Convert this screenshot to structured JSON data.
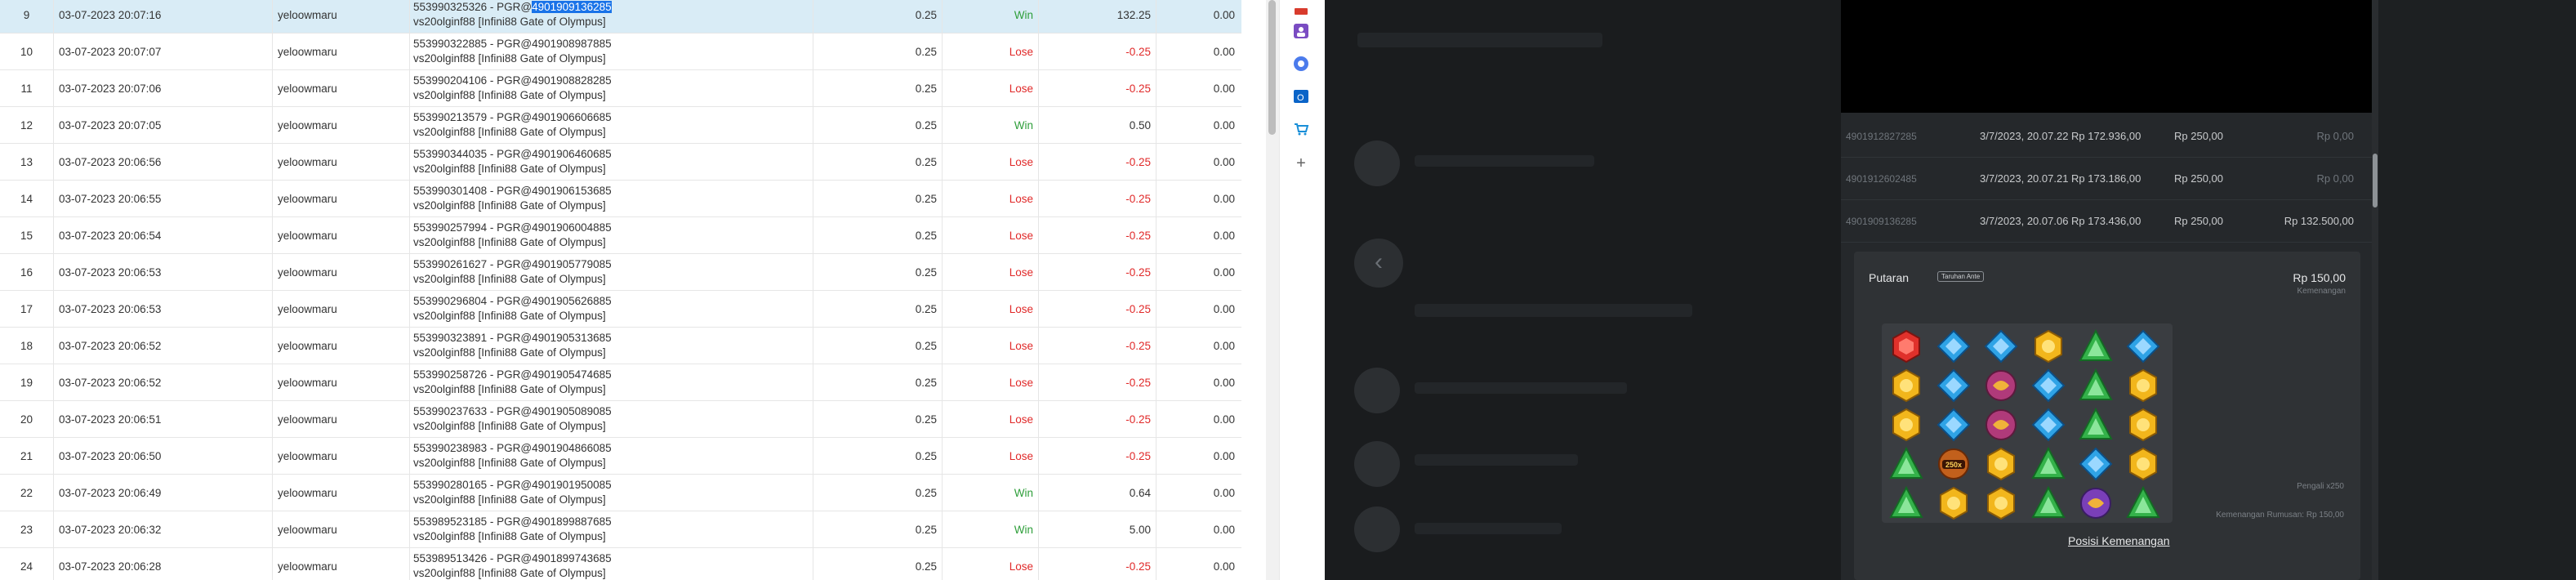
{
  "bet_table": {
    "rows": [
      {
        "no": "9",
        "date": "03-07-2023 20:07:16",
        "user": "yeloowmaru",
        "desc_prefix": "553990325326 - PGR@",
        "desc_id": "4901909136285",
        "desc2": "vs20olginf88 [Infini88 Gate of Olympus]",
        "bet": "0.25",
        "result": "Win",
        "winloss": "132.25",
        "balance": "0.00",
        "selected": true
      },
      {
        "no": "10",
        "date": "03-07-2023 20:07:07",
        "user": "yeloowmaru",
        "desc_prefix": "553990322885 - PGR@",
        "desc_id": "4901908987885",
        "desc2": "vs20olginf88 [Infini88 Gate of Olympus]",
        "bet": "0.25",
        "result": "Lose",
        "winloss": "-0.25",
        "balance": "0.00"
      },
      {
        "no": "11",
        "date": "03-07-2023 20:07:06",
        "user": "yeloowmaru",
        "desc_prefix": "553990204106 - PGR@",
        "desc_id": "4901908828285",
        "desc2": "vs20olginf88 [Infini88 Gate of Olympus]",
        "bet": "0.25",
        "result": "Lose",
        "winloss": "-0.25",
        "balance": "0.00"
      },
      {
        "no": "12",
        "date": "03-07-2023 20:07:05",
        "user": "yeloowmaru",
        "desc_prefix": "553990213579 - PGR@",
        "desc_id": "4901906606685",
        "desc2": "vs20olginf88 [Infini88 Gate of Olympus]",
        "bet": "0.25",
        "result": "Win",
        "winloss": "0.50",
        "balance": "0.00"
      },
      {
        "no": "13",
        "date": "03-07-2023 20:06:56",
        "user": "yeloowmaru",
        "desc_prefix": "553990344035 - PGR@",
        "desc_id": "4901906460685",
        "desc2": "vs20olginf88 [Infini88 Gate of Olympus]",
        "bet": "0.25",
        "result": "Lose",
        "winloss": "-0.25",
        "balance": "0.00"
      },
      {
        "no": "14",
        "date": "03-07-2023 20:06:55",
        "user": "yeloowmaru",
        "desc_prefix": "553990301408 - PGR@",
        "desc_id": "4901906153685",
        "desc2": "vs20olginf88 [Infini88 Gate of Olympus]",
        "bet": "0.25",
        "result": "Lose",
        "winloss": "-0.25",
        "balance": "0.00"
      },
      {
        "no": "15",
        "date": "03-07-2023 20:06:54",
        "user": "yeloowmaru",
        "desc_prefix": "553990257994 - PGR@",
        "desc_id": "4901906004885",
        "desc2": "vs20olginf88 [Infini88 Gate of Olympus]",
        "bet": "0.25",
        "result": "Lose",
        "winloss": "-0.25",
        "balance": "0.00"
      },
      {
        "no": "16",
        "date": "03-07-2023 20:06:53",
        "user": "yeloowmaru",
        "desc_prefix": "553990261627 - PGR@",
        "desc_id": "4901905779085",
        "desc2": "vs20olginf88 [Infini88 Gate of Olympus]",
        "bet": "0.25",
        "result": "Lose",
        "winloss": "-0.25",
        "balance": "0.00"
      },
      {
        "no": "17",
        "date": "03-07-2023 20:06:53",
        "user": "yeloowmaru",
        "desc_prefix": "553990296804 - PGR@",
        "desc_id": "4901905626885",
        "desc2": "vs20olginf88 [Infini88 Gate of Olympus]",
        "bet": "0.25",
        "result": "Lose",
        "winloss": "-0.25",
        "balance": "0.00"
      },
      {
        "no": "18",
        "date": "03-07-2023 20:06:52",
        "user": "yeloowmaru",
        "desc_prefix": "553990323891 - PGR@",
        "desc_id": "4901905313685",
        "desc2": "vs20olginf88 [Infini88 Gate of Olympus]",
        "bet": "0.25",
        "result": "Lose",
        "winloss": "-0.25",
        "balance": "0.00"
      },
      {
        "no": "19",
        "date": "03-07-2023 20:06:52",
        "user": "yeloowmaru",
        "desc_prefix": "553990258726 - PGR@",
        "desc_id": "4901905474685",
        "desc2": "vs20olginf88 [Infini88 Gate of Olympus]",
        "bet": "0.25",
        "result": "Lose",
        "winloss": "-0.25",
        "balance": "0.00"
      },
      {
        "no": "20",
        "date": "03-07-2023 20:06:51",
        "user": "yeloowmaru",
        "desc_prefix": "553990237633 - PGR@",
        "desc_id": "4901905089085",
        "desc2": "vs20olginf88 [Infini88 Gate of Olympus]",
        "bet": "0.25",
        "result": "Lose",
        "winloss": "-0.25",
        "balance": "0.00"
      },
      {
        "no": "21",
        "date": "03-07-2023 20:06:50",
        "user": "yeloowmaru",
        "desc_prefix": "553990238983 - PGR@",
        "desc_id": "4901904866085",
        "desc2": "vs20olginf88 [Infini88 Gate of Olympus]",
        "bet": "0.25",
        "result": "Lose",
        "winloss": "-0.25",
        "balance": "0.00"
      },
      {
        "no": "22",
        "date": "03-07-2023 20:06:49",
        "user": "yeloowmaru",
        "desc_prefix": "553990280165 - PGR@",
        "desc_id": "4901901950085",
        "desc2": "vs20olginf88 [Infini88 Gate of Olympus]",
        "bet": "0.25",
        "result": "Win",
        "winloss": "0.64",
        "balance": "0.00"
      },
      {
        "no": "23",
        "date": "03-07-2023 20:06:32",
        "user": "yeloowmaru",
        "desc_prefix": "553989523185 - PGR@",
        "desc_id": "4901899887685",
        "desc2": "vs20olginf88 [Infini88 Gate of Olympus]",
        "bet": "0.25",
        "result": "Win",
        "winloss": "5.00",
        "balance": "0.00"
      },
      {
        "no": "24",
        "date": "03-07-2023 20:06:28",
        "user": "yeloowmaru",
        "desc_prefix": "553989513426 - PGR@",
        "desc_id": "4901899743685",
        "desc2": "vs20olginf88 [Infini88 Gate of Olympus]",
        "bet": "0.25",
        "result": "Lose",
        "winloss": "-0.25",
        "balance": "0.00"
      }
    ]
  },
  "browser_sidebar": {
    "icons": [
      "app-icon-red",
      "contacts-icon",
      "circle-app-icon",
      "outlook-icon",
      "shopping-cart-icon",
      "plus-icon"
    ]
  },
  "game_history": {
    "spins": [
      {
        "id": "4901912827285",
        "date": "3/7/2023, 20.07.22",
        "balance": "Rp 172.936,00",
        "bet": "Rp 250,00",
        "win": "Rp 0,00"
      },
      {
        "id": "4901912602485",
        "date": "3/7/2023, 20.07.21",
        "balance": "Rp 173.186,00",
        "bet": "Rp 250,00",
        "win": "Rp 0,00"
      },
      {
        "id": "4901909136285",
        "date": "3/7/2023, 20.07.06",
        "balance": "Rp 173.436,00",
        "bet": "Rp 250,00",
        "win": "Rp 132.500,00"
      }
    ],
    "detail": {
      "title": "Putaran",
      "badge": "Taruhan Ante",
      "amount": "Rp 150,00",
      "amount_label": "Kemenangan",
      "multiplier_label": "Pengali x250",
      "bonus_label": "Kemenangan Rumusan: Rp 150,00",
      "link": "Posisi Kemenangan"
    },
    "grid": [
      [
        "red",
        "blue",
        "blue",
        "yellow",
        "green",
        "blue"
      ],
      [
        "yellow",
        "blue",
        "purple",
        "blue",
        "green",
        "yellow"
      ],
      [
        "yellow",
        "blue",
        "purple",
        "blue",
        "green",
        "yellow"
      ],
      [
        "green",
        "crown",
        "yellow",
        "green",
        "blue",
        "yellow"
      ],
      [
        "green",
        "yellow",
        "yellow",
        "green",
        "violet",
        "green"
      ]
    ],
    "gem_colors": {
      "red": "#e0312b",
      "blue": "#2fa3e6",
      "yellow": "#f2b61c",
      "green": "#34b24a",
      "purple": "#b03a7a",
      "violet": "#7a3fb8",
      "crown": "#c2601c"
    },
    "crown_label": "250x"
  }
}
